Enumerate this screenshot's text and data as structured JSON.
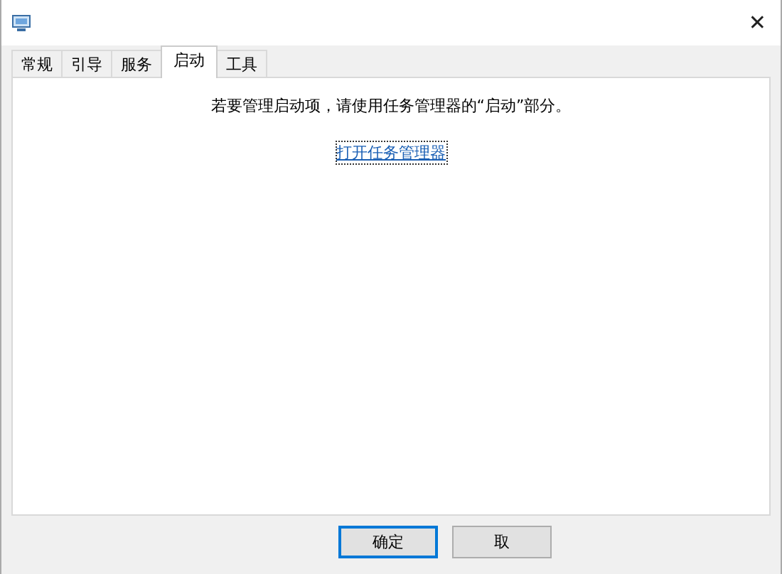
{
  "window": {
    "close": "✕"
  },
  "tabs": [
    {
      "label": "常规",
      "selected": false
    },
    {
      "label": "引导",
      "selected": false
    },
    {
      "label": "服务",
      "selected": false
    },
    {
      "label": "启动",
      "selected": true
    },
    {
      "label": "工具",
      "selected": false
    }
  ],
  "startup": {
    "message": "若要管理启动项，请使用任务管理器的“启动”部分。",
    "link": "打开任务管理器"
  },
  "buttons": [
    {
      "label": "确定",
      "kind": "default"
    },
    {
      "label": "取",
      "kind": "normal"
    }
  ]
}
